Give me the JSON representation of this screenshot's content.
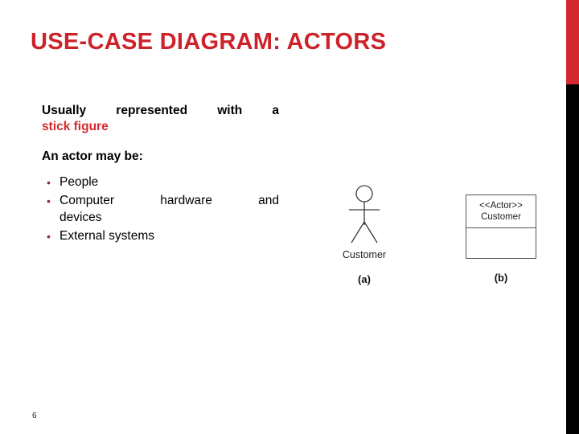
{
  "slide": {
    "title": "USE-CASE DIAGRAM: ACTORS",
    "page_number": "6",
    "accent_color": "#cc2229",
    "edge_bar_red_color": "#d42a2f",
    "edge_bar_black_color": "#000000"
  },
  "content": {
    "lead_paragraph_plain": "Usually represented with a",
    "lead_paragraph_emphasis": "stick figure",
    "sub_heading": "An actor may be:",
    "bullets": [
      {
        "text": "People",
        "wrapped": false,
        "line1": "People",
        "line2": ""
      },
      {
        "text": "Computer hardware and devices",
        "wrapped": true,
        "line1": "Computer   hardware   and",
        "line2": "devices"
      },
      {
        "text": "External systems",
        "wrapped": false,
        "line1": "External systems",
        "line2": ""
      }
    ]
  },
  "figure": {
    "part_a": {
      "label": "(a)",
      "actor_name": "Customer",
      "icon": "stick-figure-actor-icon"
    },
    "part_b": {
      "label": "(b)",
      "stereotype": "<<Actor>>",
      "class_name": "Customer",
      "icon": "uml-class-box-icon"
    }
  }
}
